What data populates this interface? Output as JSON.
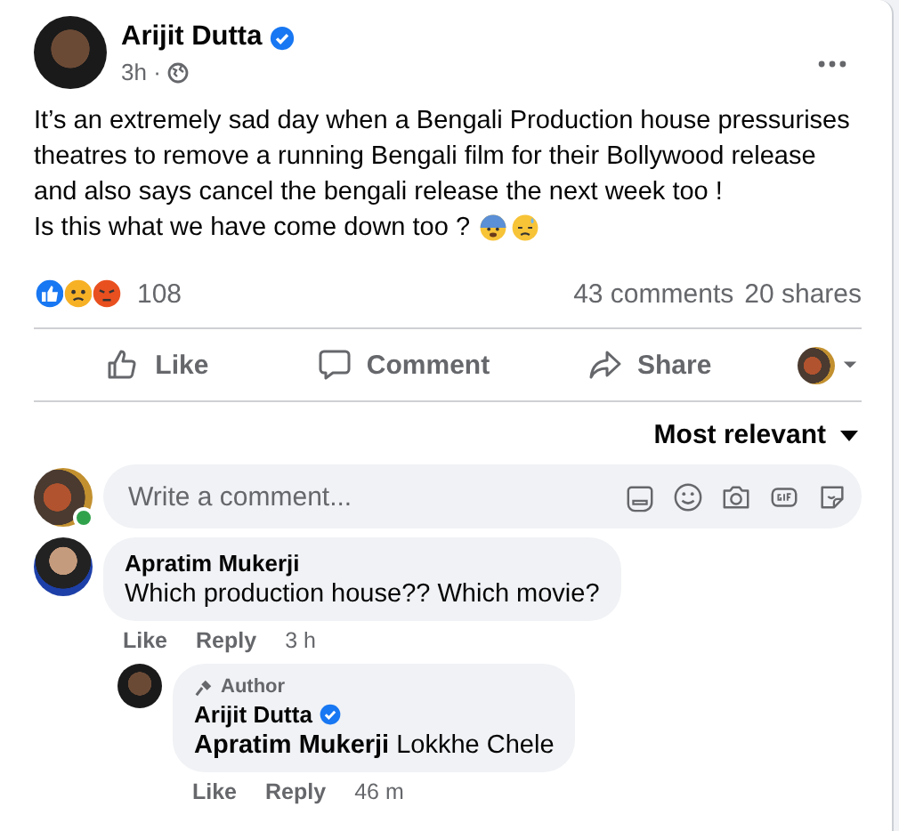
{
  "post": {
    "author": "Arijit Dutta",
    "verified": true,
    "time": "3h ·",
    "paragraphs": [
      "It’s an extremely sad day when a Bengali Production house pressurises theatres to remove a running Bengali film for their Bollywood release and also says cancel the bengali release the next week too !",
      "Is this what we have come down too ?"
    ]
  },
  "stats": {
    "reactions": "108",
    "comments": "43 comments",
    "shares": "20 shares"
  },
  "actions": [
    {
      "kind": "like",
      "label": "Like"
    },
    {
      "kind": "comment",
      "label": "Comment"
    },
    {
      "kind": "share",
      "label": "Share"
    }
  ],
  "sort": "Most relevant",
  "composer": {
    "placeholder": "Write a comment...",
    "online": true
  },
  "comments": [
    {
      "author": "Apratim Mukerji",
      "text": "Which production house?? Which movie?",
      "actions": [
        "Like",
        "Reply"
      ],
      "time": "3 h",
      "replies": [
        {
          "badge": "Author",
          "author": "Arijit Dutta",
          "verified": true,
          "mention": "Apratim Mukerji",
          "text": "Lokkhe Chele",
          "actions": [
            "Like",
            "Reply"
          ],
          "time": "46 m"
        }
      ]
    }
  ]
}
